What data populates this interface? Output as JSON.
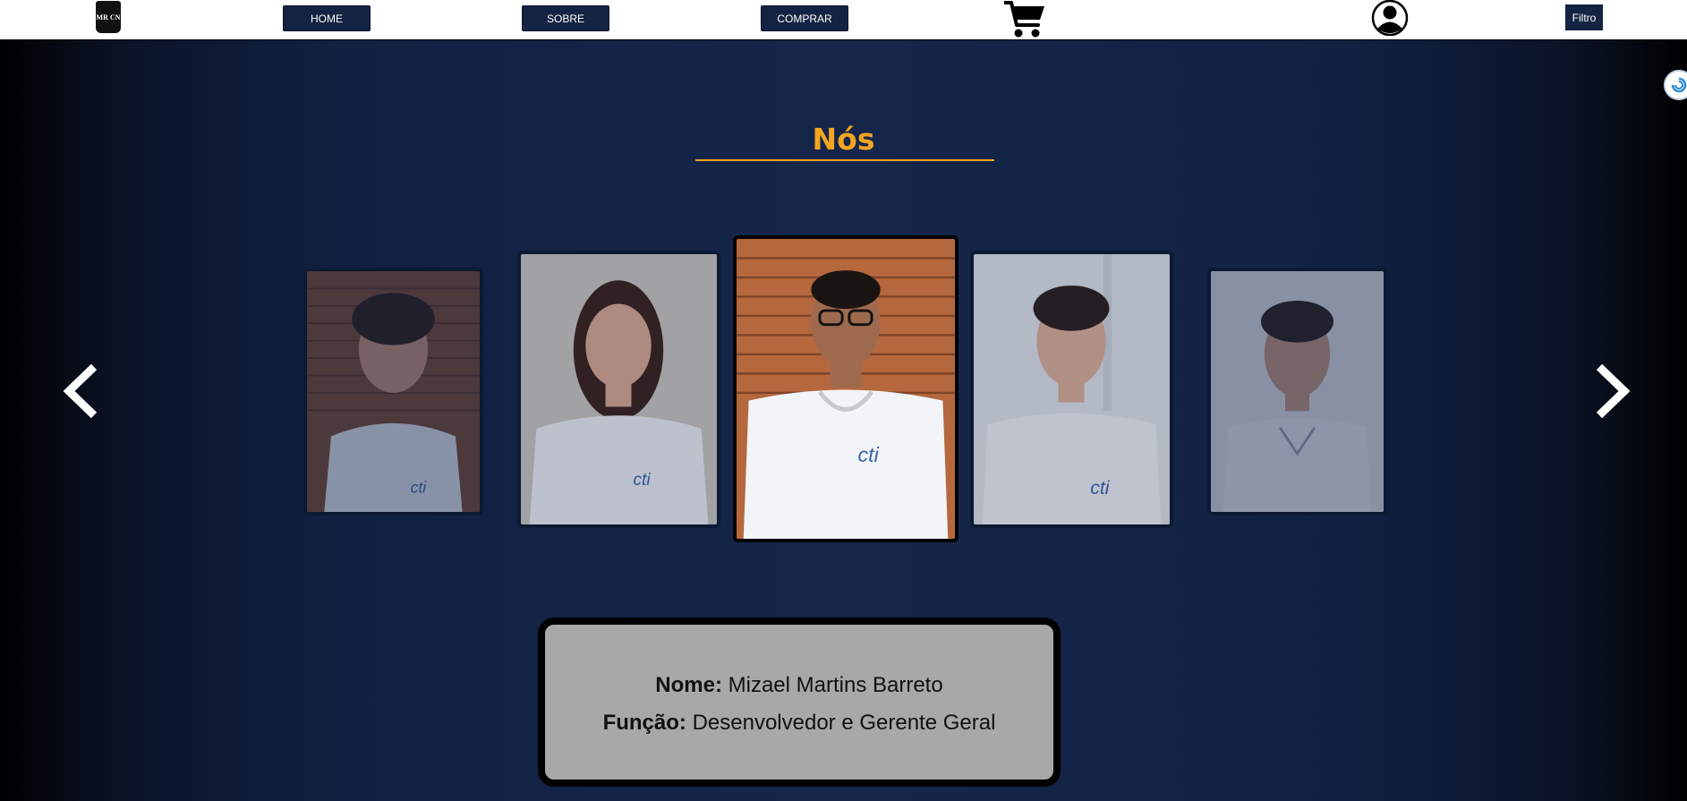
{
  "nav": {
    "logo_text": "MR CN",
    "home_label": "HOME",
    "about_label": "SOBRE",
    "buy_label": "COMPRAR",
    "filter_label": "Filtro"
  },
  "section": {
    "title": "Nós"
  },
  "team_card": {
    "name_label": "Nome:",
    "name_value": "Mizael Martins Barreto",
    "role_label": "Função:",
    "role_value": "Desenvolvedor e Gerente Geral"
  },
  "colors": {
    "accent": "#f3a521",
    "nav_button": "#142341",
    "background": "#15264a",
    "card": "#a8a8a8"
  },
  "icons": [
    "cart-icon",
    "user-profile-icon",
    "chevron-left-icon",
    "chevron-right-icon"
  ]
}
